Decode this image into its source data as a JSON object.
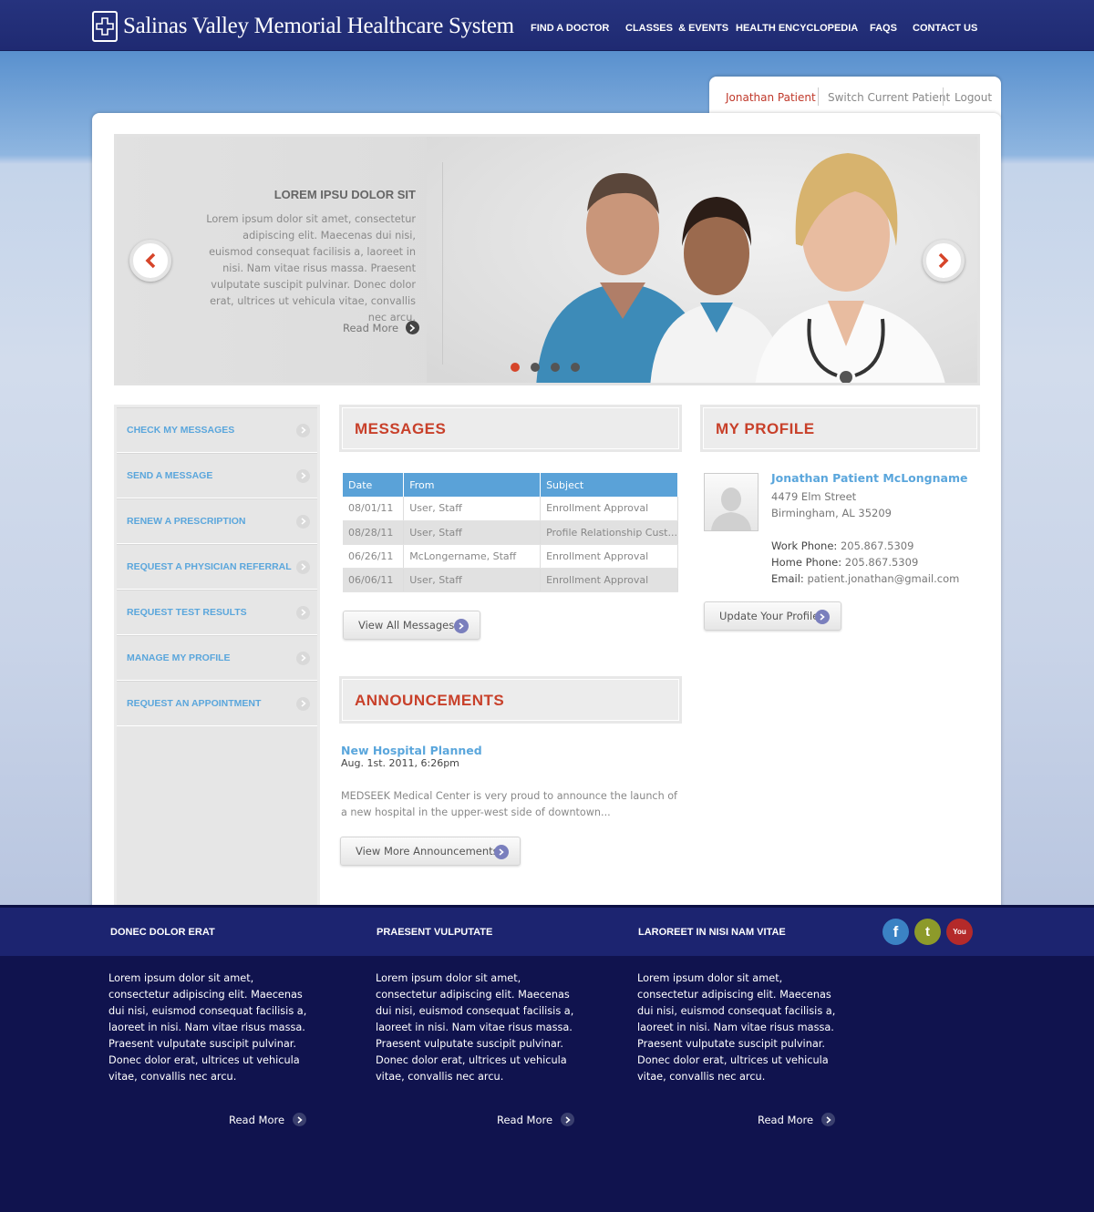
{
  "header": {
    "logo_text": "Salinas Valley Memorial Healthcare System",
    "nav": [
      "FIND A DOCTOR",
      "CLASSES  & EVENTS",
      "HEALTH ENCYCLOPEDIA",
      "FAQS",
      "CONTACT US"
    ]
  },
  "user_tabs": {
    "current": "Jonathan Patient",
    "switch": "Switch Current Patient",
    "logout": "Logout"
  },
  "hero": {
    "title": "LOREM IPSU DOLOR SIT",
    "text": "Lorem ipsum dolor sit amet, consectetur adipiscing elit. Maecenas dui nisi, euismod consequat facilisis a, laoreet in nisi. Nam vitae risus massa. Praesent vulputate suscipit pulvinar. Donec dolor erat, ultrices ut vehicula vitae, convallis nec arcu.",
    "read_more": "Read More",
    "slide_count": 4,
    "active_slide": 1
  },
  "sidebar": {
    "items": [
      "CHECK MY MESSAGES",
      "SEND A MESSAGE",
      "RENEW A PRESCRIPTION",
      "REQUEST A PHYSICIAN REFERRAL",
      "REQUEST TEST RESULTS",
      "MANAGE MY PROFILE",
      "REQUEST AN APPOINTMENT"
    ]
  },
  "messages": {
    "title": "MESSAGES",
    "columns": [
      "Date",
      "From",
      "Subject"
    ],
    "rows": [
      [
        "08/01/11",
        "User, Staff",
        "Enrollment Approval"
      ],
      [
        "08/28/11",
        "User, Staff",
        "Profile Relationship Cust..."
      ],
      [
        "06/26/11",
        "McLongername, Staff",
        "Enrollment Approval"
      ],
      [
        "06/06/11",
        "User, Staff",
        "Enrollment Approval"
      ]
    ],
    "button": "View All Messages"
  },
  "profile": {
    "title": "MY PROFILE",
    "name": "Jonathan Patient McLongname",
    "address1": "4479 Elm Street",
    "address2": "Birmingham, AL 35209",
    "work_label": "Work Phone:",
    "work_phone": "205.867.5309",
    "home_label": "Home Phone:",
    "home_phone": "205.867.5309",
    "email_label": "Email:",
    "email": "patient.jonathan@gmail.com",
    "button": "Update Your Profile"
  },
  "announcements": {
    "title": "ANNOUNCEMENTS",
    "item_title": "New Hospital Planned",
    "item_date": "Aug. 1st. 2011, 6:26pm",
    "item_text": "MEDSEEK Medical Center is very proud to announce the launch of a new hospital in the upper-west side of downtown...",
    "button": "View More Announcements"
  },
  "footer": {
    "columns": [
      {
        "heading": "DONEC DOLOR ERAT",
        "text": "Lorem ipsum dolor sit amet, consectetur adipiscing elit. Maecenas dui nisi, euismod consequat facilisis a, laoreet in nisi. Nam vitae risus massa. Praesent vulputate suscipit pulvinar. Donec dolor erat, ultrices ut vehicula vitae, convallis nec arcu.",
        "more": "Read More"
      },
      {
        "heading": "PRAESENT VULPUTATE",
        "text": "Lorem ipsum dolor sit amet, consectetur adipiscing elit. Maecenas dui nisi, euismod consequat facilisis a, laoreet in nisi. Nam vitae risus massa. Praesent vulputate suscipit pulvinar. Donec dolor erat, ultrices ut vehicula vitae, convallis nec arcu.",
        "more": "Read More"
      },
      {
        "heading": "LAROREET IN NISI NAM VITAE",
        "text": "Lorem ipsum dolor sit amet, consectetur adipiscing elit. Maecenas dui nisi, euismod consequat facilisis a, laoreet in nisi. Nam vitae risus massa. Praesent vulputate suscipit pulvinar. Donec dolor erat, ultrices ut vehicula vitae, convallis nec arcu.",
        "more": "Read More"
      }
    ],
    "social": [
      {
        "name": "facebook-icon",
        "glyph": "f",
        "color": "#3b82c4"
      },
      {
        "name": "twitter-icon",
        "glyph": "t",
        "color": "#8d9a2a"
      },
      {
        "name": "youtube-icon",
        "glyph": "You",
        "color": "#b42a2a"
      }
    ]
  },
  "colors": {
    "accent_red": "#c8402a",
    "link_blue": "#5aa6dc",
    "header_blue": "#26337e",
    "footer_navy": "#10134e"
  }
}
